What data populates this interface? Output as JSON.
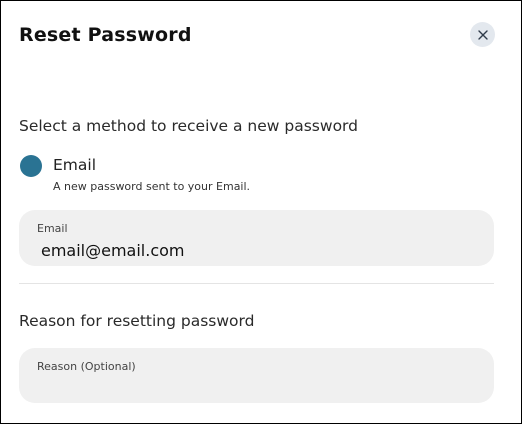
{
  "dialog": {
    "title": "Reset Password",
    "close_icon": "close-icon",
    "method_heading": "Select a method to receive a new password",
    "method": {
      "label": "Email",
      "description": "A new password sent to your Email.",
      "selected": true,
      "color": "#2a7393"
    },
    "email_field": {
      "label": "Email",
      "value": "email@email.com"
    },
    "reason_heading": "Reason for resetting password",
    "reason_field": {
      "placeholder": "Reason (Optional)",
      "value": ""
    }
  }
}
